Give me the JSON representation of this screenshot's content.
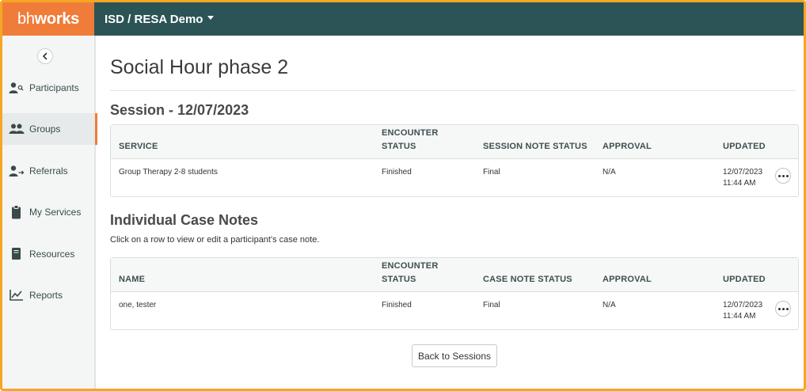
{
  "brand": {
    "part1": "bh",
    "part2": "works",
    "color": "#f07c3a"
  },
  "header": {
    "org_selector": "ISD / RESA Demo",
    "bg_color": "#2c5456"
  },
  "sidebar": {
    "collapse_icon": "chevron-left-icon",
    "items": [
      {
        "label": "Participants",
        "icon": "person-search-icon",
        "active": false
      },
      {
        "label": "Groups",
        "icon": "people-icon",
        "active": true
      },
      {
        "label": "Referrals",
        "icon": "person-arrow-icon",
        "active": false
      },
      {
        "label": "My Services",
        "icon": "clipboard-icon",
        "active": false
      },
      {
        "label": "Resources",
        "icon": "book-icon",
        "active": false
      },
      {
        "label": "Reports",
        "icon": "line-chart-icon",
        "active": false
      }
    ]
  },
  "main": {
    "title": "Social Hour phase 2",
    "session": {
      "title": "Session - 12/07/2023",
      "columns": [
        "SERVICE",
        "ENCOUNTER STATUS",
        "SESSION NOTE STATUS",
        "APPROVAL",
        "UPDATED"
      ],
      "rows": [
        {
          "service": "Group Therapy 2-8 students",
          "encounter_status": "Finished",
          "note_status": "Final",
          "approval": "N/A",
          "updated_date": "12/07/2023",
          "updated_time": "11:44 AM"
        }
      ]
    },
    "case_notes": {
      "title": "Individual Case Notes",
      "hint": "Click on a row to view or edit a participant's case note.",
      "columns": [
        "NAME",
        "ENCOUNTER STATUS",
        "CASE NOTE STATUS",
        "APPROVAL",
        "UPDATED"
      ],
      "rows": [
        {
          "name": "one, tester",
          "encounter_status": "Finished",
          "note_status": "Final",
          "approval": "N/A",
          "updated_date": "12/07/2023",
          "updated_time": "11:44 AM"
        }
      ]
    },
    "back_button": "Back to Sessions"
  }
}
